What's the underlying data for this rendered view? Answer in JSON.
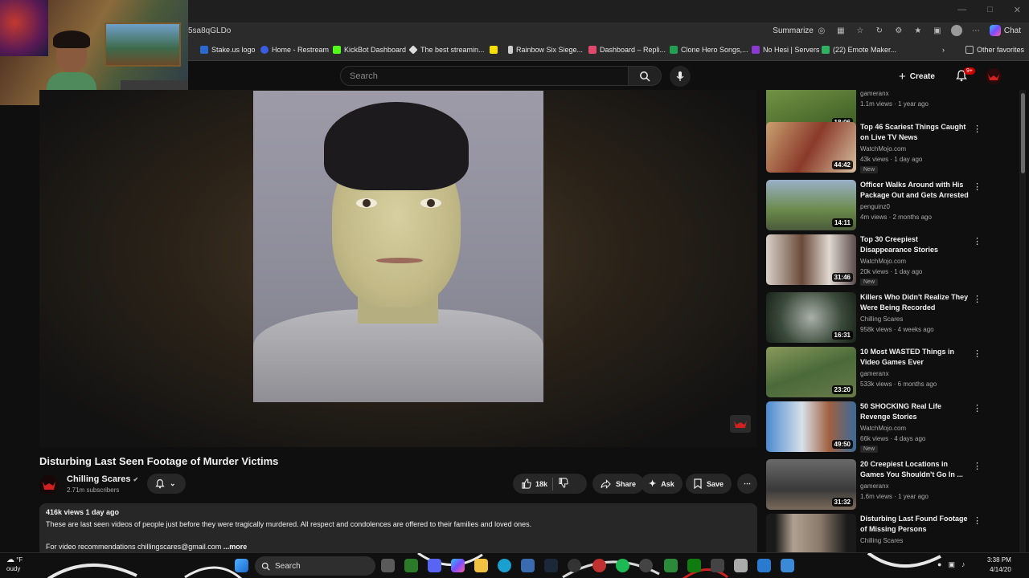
{
  "browser": {
    "url_fragment": "5sa8qGLDo",
    "summarize_label": "Summarize",
    "chat_label": "Chat",
    "other_favorites": "Other favorites"
  },
  "bookmarks": [
    {
      "label": "Stake.us logo",
      "color": "#2a6ad0"
    },
    {
      "label": "Home - Restream",
      "color": "#3b5ce0"
    },
    {
      "label": "KickBot Dashboard",
      "color": "#53fc18"
    },
    {
      "label": "The best streamin...",
      "color": "#dddddd"
    },
    {
      "label": "",
      "color": "#f7e000"
    },
    {
      "label": "Rainbow Six Siege...",
      "color": "#cccccc"
    },
    {
      "label": "Dashboard – Repli...",
      "color": "#e04a6a"
    },
    {
      "label": "Clone Hero Songs,...",
      "color": "#20a050"
    },
    {
      "label": "No Hesi | Servers",
      "color": "#8a3ad0"
    },
    {
      "label": "(22) Emote Maker...",
      "color": "#30b060"
    }
  ],
  "youtube": {
    "search_placeholder": "Search",
    "create_label": "Create",
    "notification_count": "9+"
  },
  "video": {
    "title": "Disturbing Last Seen Footage of Murder Victims",
    "channel": "Chilling Scares",
    "subscribers": "2.71m subscribers",
    "likes": "18k",
    "share_label": "Share",
    "ask_label": "Ask",
    "save_label": "Save",
    "views_date": "416k views  1 day ago",
    "description_line1": "These are last seen videos of people just before they were tragically murdered. All respect and condolences are offered to their families and loved ones.",
    "description_line2": "For video recommendations chillingscares@gmail.com",
    "more_label": "...more"
  },
  "recommendations": [
    {
      "title": "",
      "channel": "gameranx",
      "meta": "1.1m views · 1 year ago",
      "duration": "18:06",
      "new": "",
      "thumb": "#4a6a2a"
    },
    {
      "title": "Top 46 Scariest Things Caught on Live TV News",
      "channel": "WatchMojo.com",
      "meta": "43k views · 1 day ago",
      "duration": "44:42",
      "new": "New",
      "thumb": "#8a3a2a"
    },
    {
      "title": "Officer Walks Around with His Package Out and Gets Arrested",
      "channel": "penguinz0",
      "meta": "4m views · 2 months ago",
      "duration": "14:11",
      "new": "",
      "thumb": "#5a7a3a"
    },
    {
      "title": "Top 30 Creepiest Disappearance Stories",
      "channel": "WatchMojo.com",
      "meta": "20k views · 1 day ago",
      "duration": "31:46",
      "new": "New",
      "thumb": "#6a5a5a"
    },
    {
      "title": "Killers Who Didn't Realize They Were Being Recorded",
      "channel": "Chilling Scares",
      "meta": "958k views · 4 weeks ago",
      "duration": "16:31",
      "new": "",
      "thumb": "#3a4a3a"
    },
    {
      "title": "10 Most WASTED Things in Video Games Ever",
      "channel": "gameranx",
      "meta": "533k views · 6 months ago",
      "duration": "23:20",
      "new": "",
      "thumb": "#5a6a3a"
    },
    {
      "title": "50 SHOCKING Real Life Revenge Stories",
      "channel": "WatchMojo.com",
      "meta": "66k views · 4 days ago",
      "duration": "49:50",
      "new": "New",
      "thumb": "#3a6a9a"
    },
    {
      "title": "20 Creepiest Locations in Games You Shouldn't Go In ...",
      "channel": "gameranx",
      "meta": "1.6m views · 1 year ago",
      "duration": "31:32",
      "new": "",
      "thumb": "#5a5a5a"
    },
    {
      "title": "Disturbing Last Found Footage of Missing Persons",
      "channel": "Chilling Scares",
      "meta": "",
      "duration": "",
      "new": "",
      "thumb": "#7a7060"
    }
  ],
  "taskbar": {
    "weather_temp": "°F",
    "weather_cond": "oudy",
    "search_label": "Search",
    "time": "3:38 PM",
    "date": "4/14/20"
  }
}
